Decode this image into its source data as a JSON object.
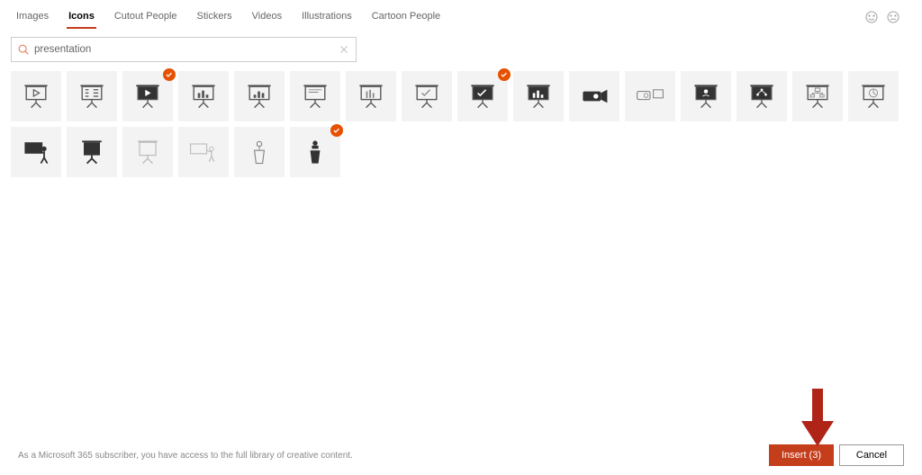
{
  "tabs": {
    "images": "Images",
    "icons": "Icons",
    "cutout": "Cutout People",
    "stickers": "Stickers",
    "videos": "Videos",
    "illustrations": "Illustrations",
    "cartoon": "Cartoon People"
  },
  "search": {
    "value": "presentation",
    "placeholder": "Search"
  },
  "icons": [
    {
      "name": "presentation-play",
      "selected": false
    },
    {
      "name": "presentation-list",
      "selected": false
    },
    {
      "name": "presentation-play-dark",
      "selected": true
    },
    {
      "name": "presentation-bars",
      "selected": false
    },
    {
      "name": "presentation-bars2",
      "selected": false
    },
    {
      "name": "presentation-blank",
      "selected": false
    },
    {
      "name": "presentation-bars3",
      "selected": false
    },
    {
      "name": "presentation-check",
      "selected": false
    },
    {
      "name": "presentation-check-dark",
      "selected": true
    },
    {
      "name": "presentation-bars-dark",
      "selected": false
    },
    {
      "name": "projector",
      "selected": false
    },
    {
      "name": "projector-screen",
      "selected": false
    },
    {
      "name": "presentation-people",
      "selected": false
    },
    {
      "name": "presentation-tree",
      "selected": false
    },
    {
      "name": "presentation-org",
      "selected": false
    },
    {
      "name": "presentation-clock",
      "selected": false
    },
    {
      "name": "presenter-board",
      "selected": false
    },
    {
      "name": "whiteboard",
      "selected": false
    },
    {
      "name": "whiteboard-light",
      "selected": false
    },
    {
      "name": "presenter-point",
      "selected": false
    },
    {
      "name": "podium",
      "selected": false
    },
    {
      "name": "podium-speaker",
      "selected": true
    }
  ],
  "footnote": "As a Microsoft 365 subscriber, you have access to the full library of creative content.",
  "buttons": {
    "insert": "Insert (3)",
    "cancel": "Cancel"
  }
}
